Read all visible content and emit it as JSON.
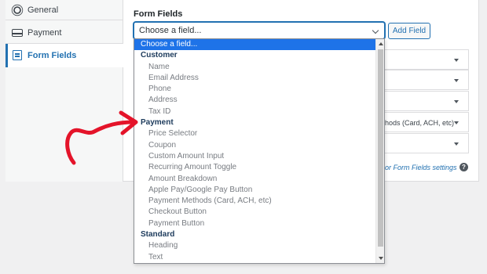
{
  "sidebar": {
    "items": [
      {
        "label": "General",
        "icon": "gear-icon"
      },
      {
        "label": "Payment",
        "icon": "credit-card-icon"
      },
      {
        "label": "Form Fields",
        "icon": "form-icon",
        "active": true
      }
    ]
  },
  "main": {
    "section_title": "Form Fields",
    "select": {
      "value": "Choose a field..."
    },
    "add_button": "Add Field",
    "field_rows": [
      {
        "text": ""
      },
      {
        "text": ""
      },
      {
        "text": ""
      },
      {
        "text": "hods (Card, ACH, etc)"
      },
      {
        "text": ""
      }
    ],
    "settings_link": "or Form Fields settings",
    "help_icon": "?"
  },
  "dropdown": {
    "options": [
      {
        "label": "Choose a field...",
        "type": "selected"
      },
      {
        "label": "Customer",
        "type": "group"
      },
      {
        "label": "Name",
        "type": "item"
      },
      {
        "label": "Email Address",
        "type": "item"
      },
      {
        "label": "Phone",
        "type": "item"
      },
      {
        "label": "Address",
        "type": "item"
      },
      {
        "label": "Tax ID",
        "type": "item"
      },
      {
        "label": "Payment",
        "type": "group"
      },
      {
        "label": "Price Selector",
        "type": "item"
      },
      {
        "label": "Coupon",
        "type": "item"
      },
      {
        "label": "Custom Amount Input",
        "type": "item"
      },
      {
        "label": "Recurring Amount Toggle",
        "type": "item"
      },
      {
        "label": "Amount Breakdown",
        "type": "item"
      },
      {
        "label": "Apple Pay/Google Pay Button",
        "type": "item"
      },
      {
        "label": "Payment Methods (Card, ACH, etc)",
        "type": "item"
      },
      {
        "label": "Checkout Button",
        "type": "item"
      },
      {
        "label": "Payment Button",
        "type": "item"
      },
      {
        "label": "Standard",
        "type": "group"
      },
      {
        "label": "Heading",
        "type": "item"
      },
      {
        "label": "Text",
        "type": "item"
      }
    ]
  },
  "colors": {
    "accent": "#2271b1",
    "selected_option": "#1e73e8",
    "group_label": "#1d3b5c",
    "annotation_arrow": "#e4142a"
  }
}
